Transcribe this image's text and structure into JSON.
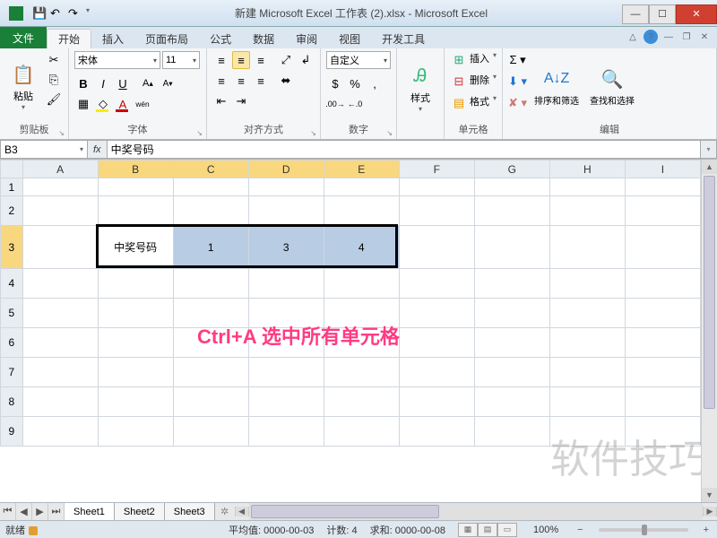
{
  "title": "新建 Microsoft Excel 工作表 (2).xlsx - Microsoft Excel",
  "ribbon": {
    "file_tab": "文件",
    "tabs": [
      "开始",
      "插入",
      "页面布局",
      "公式",
      "数据",
      "审阅",
      "视图",
      "开发工具"
    ],
    "active_ix": 0
  },
  "groups": {
    "clipboard": {
      "label": "剪贴板",
      "paste": "粘贴"
    },
    "font": {
      "label": "字体",
      "name": "宋体",
      "size": "11"
    },
    "align": {
      "label": "对齐方式"
    },
    "number": {
      "label": "数字",
      "format": "自定义"
    },
    "styles": {
      "label": "样式",
      "btn": "样式"
    },
    "cells": {
      "label": "单元格",
      "insert": "插入",
      "delete": "删除",
      "format": "格式"
    },
    "editing": {
      "label": "编辑",
      "sort": "排序和筛选",
      "find": "查找和选择"
    }
  },
  "namebox": "B3",
  "formula": "中奖号码",
  "columns": [
    "A",
    "B",
    "C",
    "D",
    "E",
    "F",
    "G",
    "H",
    "I"
  ],
  "row_count": 9,
  "sel_row": 3,
  "sel_cols": [
    2,
    3,
    4,
    5
  ],
  "cells": {
    "B3": "中奖号码",
    "C3": "1",
    "D3": "3",
    "E3": "4"
  },
  "overlay": "Ctrl+A   选中所有单元格",
  "watermark": "软件技巧",
  "sheet_tabs": [
    "Sheet1",
    "Sheet2",
    "Sheet3"
  ],
  "active_sheet": 0,
  "status": {
    "ready": "就绪",
    "avg": "平均值: 0000-00-03",
    "count": "计数: 4",
    "sum": "求和: 0000-00-08"
  },
  "zoom": "100%"
}
